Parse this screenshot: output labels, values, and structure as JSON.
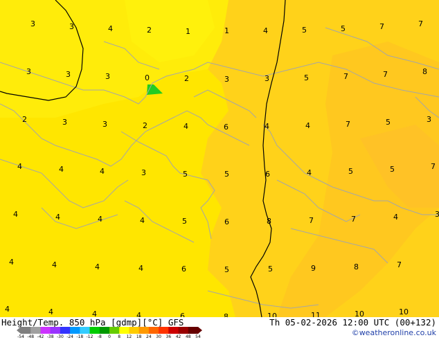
{
  "map": {
    "labels": [
      {
        "t": "3"
      },
      {
        "t": "3"
      },
      {
        "t": "4"
      },
      {
        "t": "2"
      },
      {
        "t": "1"
      },
      {
        "t": "1"
      },
      {
        "t": "4"
      },
      {
        "t": "5"
      },
      {
        "t": "5"
      },
      {
        "t": "7"
      },
      {
        "t": "7"
      },
      {
        "t": "3"
      },
      {
        "t": "3"
      },
      {
        "t": "3"
      },
      {
        "t": "0"
      },
      {
        "t": "2"
      },
      {
        "t": "3"
      },
      {
        "t": "3"
      },
      {
        "t": "5"
      },
      {
        "t": "7"
      },
      {
        "t": "7"
      },
      {
        "t": "8"
      },
      {
        "t": "2"
      },
      {
        "t": "3"
      },
      {
        "t": "3"
      },
      {
        "t": "2"
      },
      {
        "t": "4"
      },
      {
        "t": "6"
      },
      {
        "t": "4"
      },
      {
        "t": "4"
      },
      {
        "t": "7"
      },
      {
        "t": "5"
      },
      {
        "t": "3"
      },
      {
        "t": "4"
      },
      {
        "t": "4"
      },
      {
        "t": "4"
      },
      {
        "t": "3"
      },
      {
        "t": "5"
      },
      {
        "t": "5"
      },
      {
        "t": "6"
      },
      {
        "t": "4"
      },
      {
        "t": "5"
      },
      {
        "t": "5"
      },
      {
        "t": "7"
      },
      {
        "t": "4"
      },
      {
        "t": "4"
      },
      {
        "t": "4"
      },
      {
        "t": "4"
      },
      {
        "t": "5"
      },
      {
        "t": "6"
      },
      {
        "t": "8"
      },
      {
        "t": "7"
      },
      {
        "t": "7"
      },
      {
        "t": "4"
      },
      {
        "t": "3"
      },
      {
        "t": "4"
      },
      {
        "t": "4"
      },
      {
        "t": "4"
      },
      {
        "t": "4"
      },
      {
        "t": "6"
      },
      {
        "t": "5"
      },
      {
        "t": "5"
      },
      {
        "t": "9"
      },
      {
        "t": "8"
      },
      {
        "t": "7"
      },
      {
        "t": "4"
      },
      {
        "t": "4"
      },
      {
        "t": "4"
      },
      {
        "t": "4"
      },
      {
        "t": "6"
      },
      {
        "t": "8"
      },
      {
        "t": "10"
      },
      {
        "t": "11"
      },
      {
        "t": "10"
      },
      {
        "t": "10"
      }
    ]
  },
  "footer": {
    "title": "Height/Temp. 850 hPa [gdmp][°C] GFS",
    "datetime": "Th 05-02-2026 12:00 UTC (00+132)",
    "credit": "©weatheronline.co.uk"
  },
  "scale": {
    "ticks": [
      "-54",
      "-48",
      "-42",
      "-38",
      "-30",
      "-24",
      "-18",
      "-12",
      "-8",
      "0",
      "8",
      "12",
      "18",
      "24",
      "30",
      "36",
      "42",
      "48",
      "54"
    ],
    "colors": [
      "#7f7f7f",
      "#a0a0a0",
      "#cc33ff",
      "#9933ff",
      "#3333ff",
      "#0099ff",
      "#33ccff",
      "#00cc00",
      "#009900",
      "#66cc00",
      "#ffff00",
      "#ffcc00",
      "#ff9900",
      "#ff6600",
      "#ff3300",
      "#cc0000",
      "#990000",
      "#660000"
    ]
  }
}
